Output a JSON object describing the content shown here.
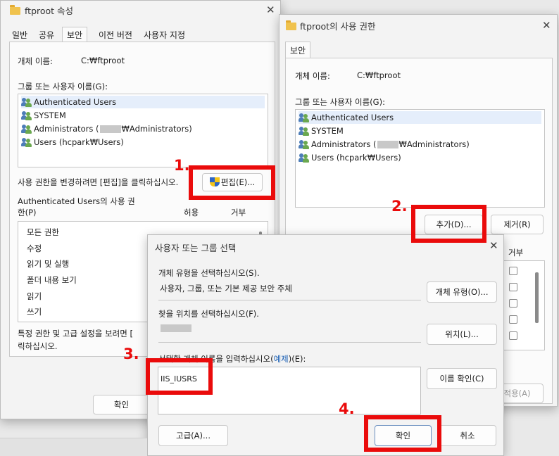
{
  "props_window": {
    "title": "ftproot 속성",
    "tabs": [
      "일반",
      "공유",
      "보안",
      "이전 버전",
      "사용자 지정"
    ],
    "object_name_label": "개체 이름:",
    "object_name_value": "C:₩ftproot",
    "group_label": "그룹 또는 사용자 이름(G):",
    "users": [
      {
        "pre": "Authenticated Users",
        "post": ""
      },
      {
        "pre": "SYSTEM",
        "post": ""
      },
      {
        "pre": "Administrators (",
        "post": "₩Administrators)"
      },
      {
        "pre": "Users (hcpark₩Users)",
        "post": ""
      }
    ],
    "edit_hint": "사용 권한을 변경하려면 [편집]을 클릭하십시오.",
    "edit_button": "편집(E)...",
    "perm_label_line1": "Authenticated Users의 사용 권",
    "perm_label_line2": "한(P)",
    "allow_header": "허용",
    "deny_header": "거부",
    "permissions": [
      "모든 권한",
      "수정",
      "읽기 및 실행",
      "폴더 내용 보기",
      "읽기",
      "쓰기"
    ],
    "advanced_hint_line1": "특정 권한 및 고급 설정을 보려면 [",
    "advanced_hint_line2": "릭하십시오.",
    "ok_button": "확인"
  },
  "perm_window": {
    "title": "ftproot의 사용 권한",
    "tab": "보안",
    "object_name_label": "개체 이름:",
    "object_name_value": "C:₩ftproot",
    "group_label": "그룹 또는 사용자 이름(G):",
    "users": [
      {
        "pre": "Authenticated Users",
        "post": ""
      },
      {
        "pre": "SYSTEM",
        "post": ""
      },
      {
        "pre": "Administrators (",
        "post": "₩Administrators)"
      },
      {
        "pre": "Users (hcpark₩Users)",
        "post": ""
      }
    ],
    "add_button": "추가(D)...",
    "remove_button": "제거(R)",
    "deny_header": "거부",
    "apply_button": "적용(A)"
  },
  "select_dialog": {
    "title": "사용자 또는 그룹 선택",
    "object_type_label": "개체 유형을 선택하십시오(S).",
    "object_type_value": "사용자, 그룹, 또는 기본 제공 보안 주체",
    "object_type_button": "개체 유형(O)...",
    "location_label": "찾을 위치를 선택하십시오(F).",
    "location_button": "위치(L)...",
    "names_label": "선택할 개체 이름을 입력하십시오(",
    "names_link": "예제",
    "names_label_end": ")(E):",
    "names_value": "IIS_IUSRS",
    "check_names_button": "이름 확인(C)",
    "advanced_button": "고급(A)...",
    "ok_button": "확인",
    "cancel_button": "취소"
  },
  "annotations": [
    "1.",
    "2.",
    "3.",
    "4."
  ],
  "colors": {
    "highlight": "#ea0b0b",
    "window_bg": "#f3f3f3",
    "selection": "#e5eefb"
  },
  "icons": [
    "folder-icon",
    "close-icon",
    "user-group-icon",
    "uac-shield-icon"
  ]
}
